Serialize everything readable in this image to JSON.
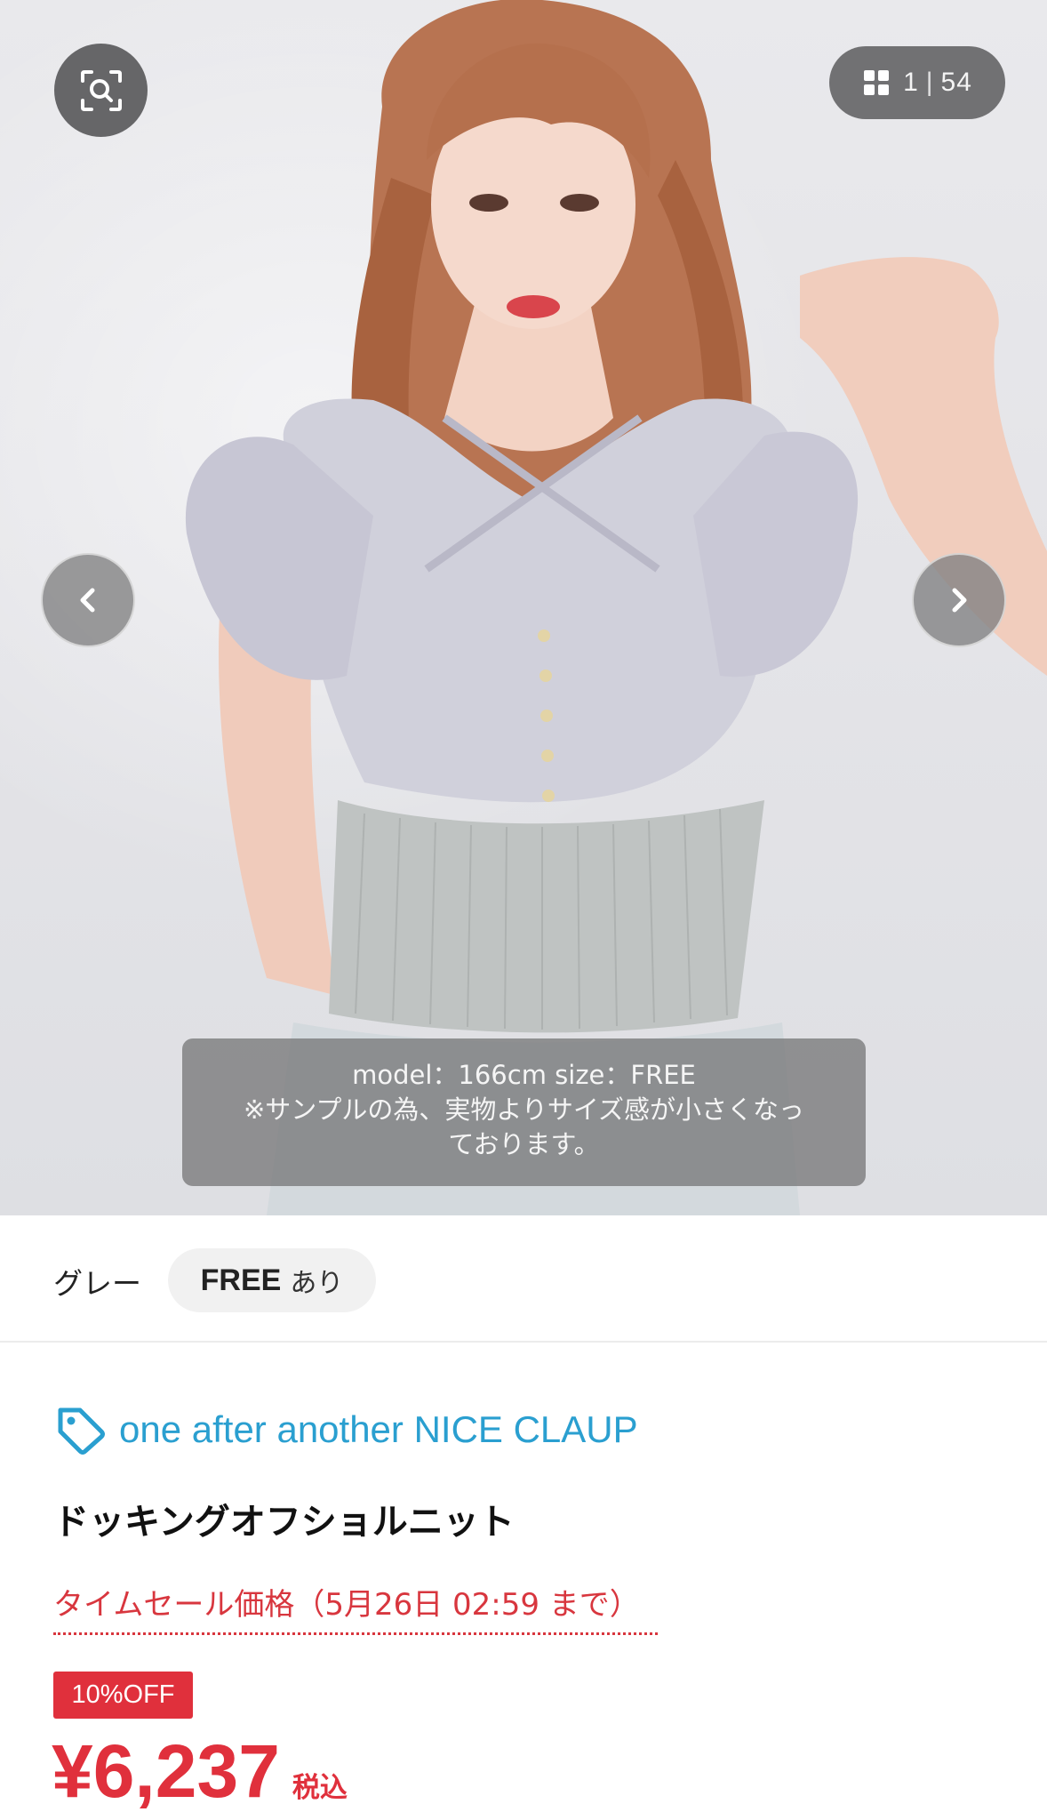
{
  "gallery": {
    "current": "1",
    "total": "54",
    "caption_line1": "model：166cm size：FREE",
    "caption_line2": "※サンプルの為、実物よりサイズ感が小さくなっ",
    "caption_line3": "ております。"
  },
  "variant": {
    "color": "グレー",
    "size": "FREE",
    "stock": "あり"
  },
  "product": {
    "brand": "one after another NICE CLAUP",
    "name": "ドッキングオフショルニット",
    "sale_label": "タイムセール価格（5月26日 02:59 まで）",
    "discount_badge": "10%OFF",
    "price": "¥6,237",
    "tax_label": "税込"
  },
  "colors": {
    "brand": "#2a9fd0",
    "sale_red": "#e0303c"
  },
  "icons": [
    "image-search-icon",
    "grid-icon",
    "chevron-left-icon",
    "chevron-right-icon",
    "tag-icon"
  ]
}
